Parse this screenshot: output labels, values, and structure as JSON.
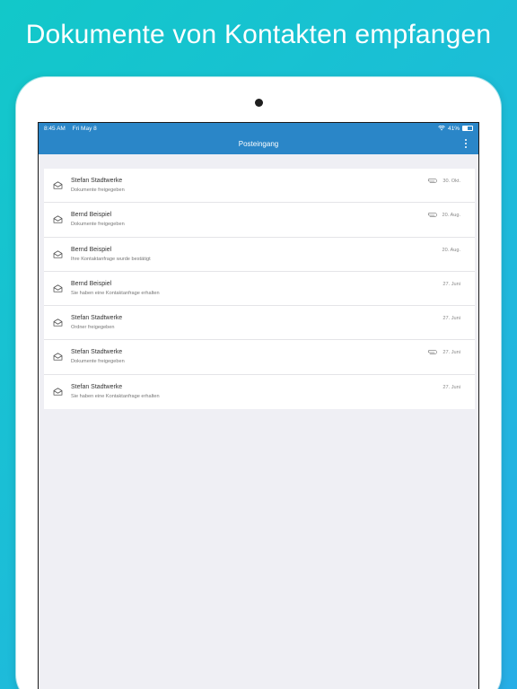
{
  "headline": "Dokumente von Kontakten empfangen",
  "status_bar": {
    "time": "8:45 AM",
    "date": "Fri May 8",
    "battery": "41%",
    "wifi_icon": "wifi-icon",
    "battery_icon": "battery-icon"
  },
  "navbar": {
    "title": "Posteingang",
    "menu_icon": "more-vertical-icon"
  },
  "colors": {
    "accent": "#2a86c8",
    "background_gradient_start": "#12c8c9",
    "background_gradient_end": "#27aee6",
    "list_background": "#efeff4"
  },
  "messages": [
    {
      "sender": "Stefan Stadtwerke",
      "subject": "Dokumente freigegeben",
      "date": "30. Okt.",
      "attachment": true
    },
    {
      "sender": "Bernd Beispiel",
      "subject": "Dokumente freigegeben",
      "date": "20. Aug.",
      "attachment": true
    },
    {
      "sender": "Bernd Beispiel",
      "subject": "Ihre Kontaktanfrage wurde bestätigt",
      "date": "20. Aug.",
      "attachment": false
    },
    {
      "sender": "Bernd Beispiel",
      "subject": "Sie haben eine Kontaktanfrage erhalten",
      "date": "27. Juni",
      "attachment": false
    },
    {
      "sender": "Stefan Stadtwerke",
      "subject": "Ordner freigegeben",
      "date": "27. Juni",
      "attachment": false
    },
    {
      "sender": "Stefan Stadtwerke",
      "subject": "Dokumente freigegeben",
      "date": "27. Juni",
      "attachment": true
    },
    {
      "sender": "Stefan Stadtwerke",
      "subject": "Sie haben eine Kontaktanfrage erhalten",
      "date": "27. Juni",
      "attachment": false
    }
  ]
}
